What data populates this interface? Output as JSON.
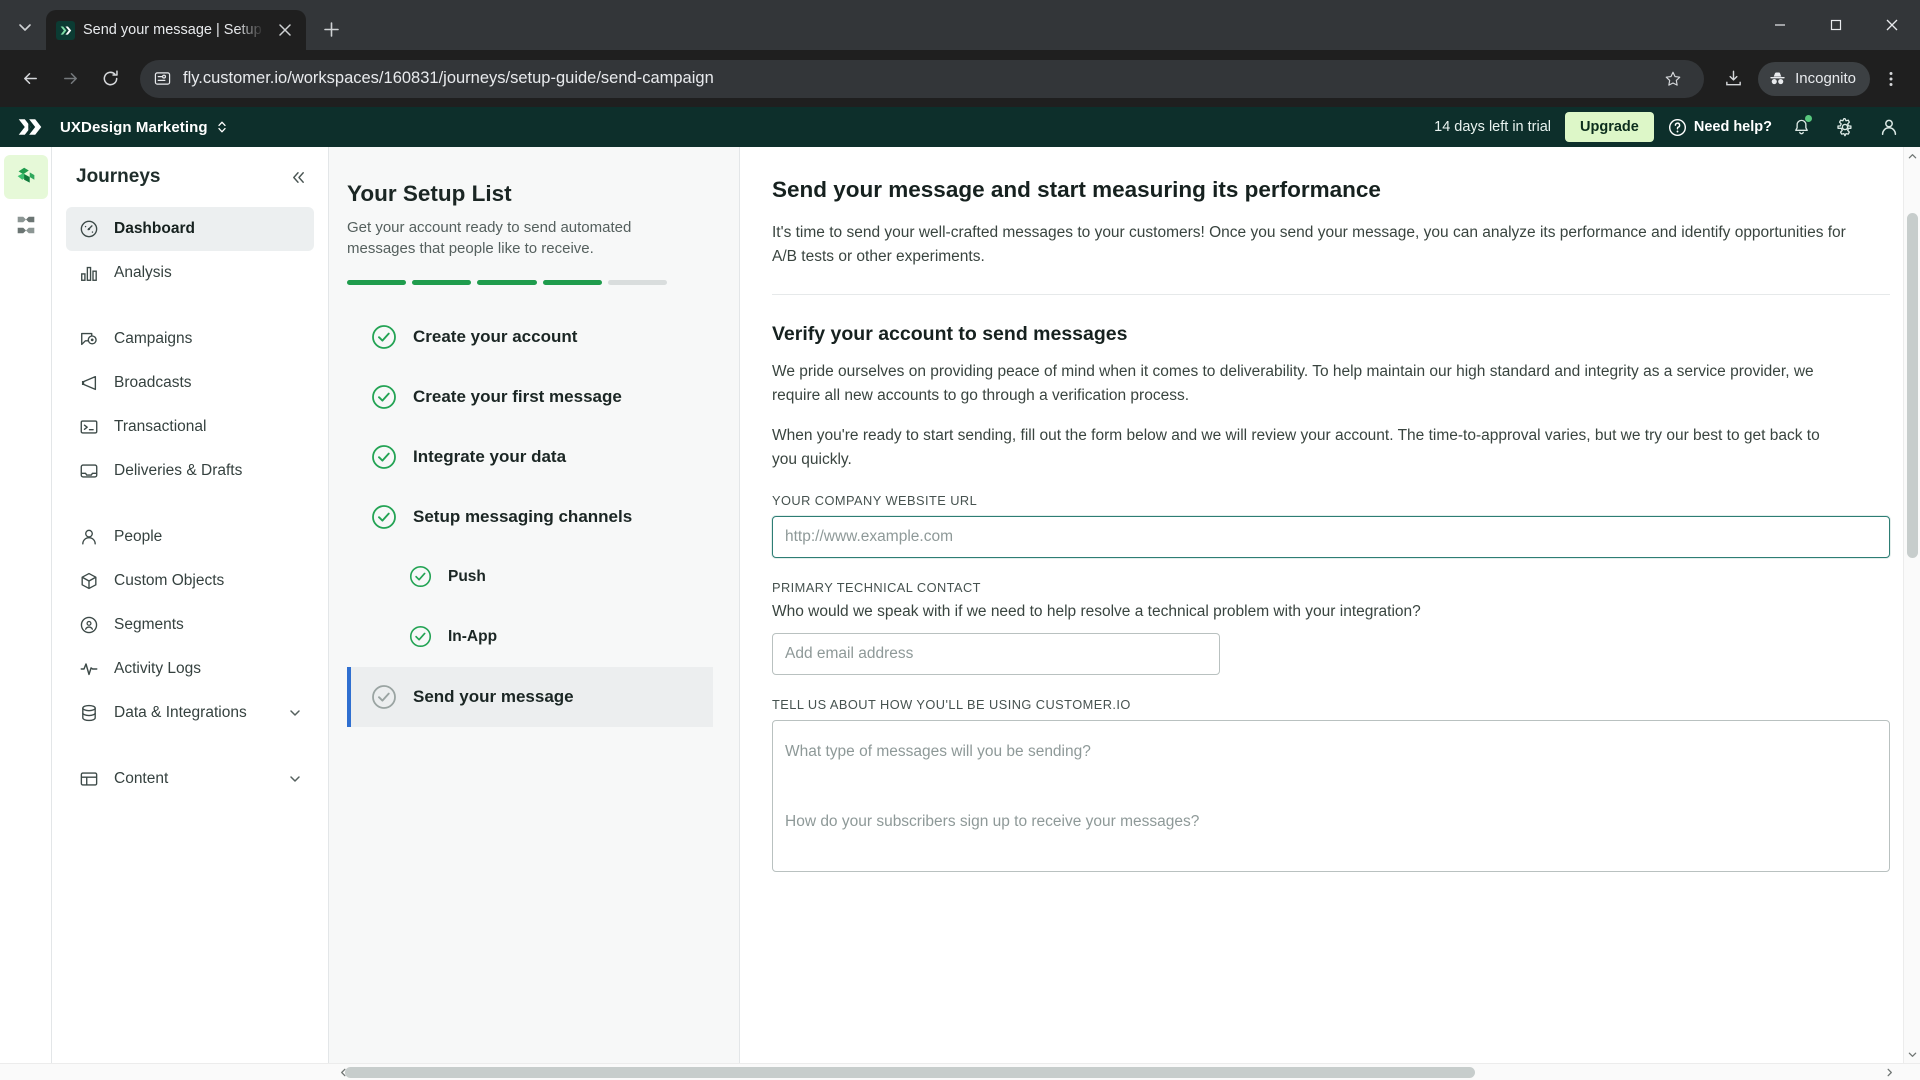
{
  "browser": {
    "tab": {
      "title": "Send your message | Setup Gui",
      "favicon_icon": "customerio-logo-icon",
      "close_icon": "close-icon"
    },
    "tab_list_icon": "chevron-down-icon",
    "new_tab_icon": "plus-icon",
    "window": {
      "minimize_icon": "minimize-icon",
      "maximize_icon": "maximize-icon",
      "close_icon": "close-icon"
    },
    "nav": {
      "back_icon": "arrow-back-icon",
      "forward_icon": "arrow-forward-icon",
      "reload_icon": "reload-icon"
    },
    "omnibox": {
      "site_info_icon": "site-settings-icon",
      "url": "fly.customer.io/workspaces/160831/journeys/setup-guide/send-campaign"
    },
    "toolbar": {
      "bookmark_icon": "star-icon",
      "download_icon": "download-icon",
      "menu_icon": "kebab-menu-icon"
    },
    "incognito": {
      "label": "Incognito",
      "icon": "incognito-icon"
    }
  },
  "app_header": {
    "logo_icon": "customerio-logo-icon",
    "workspace_name": "UXDesign Marketing",
    "workspace_switch_icon": "chevron-updown-icon",
    "trial_text": "14 days left in trial",
    "upgrade_label": "Upgrade",
    "need_help_label": "Need help?",
    "need_help_icon": "question-circle-icon",
    "notifications_icon": "bell-icon",
    "settings_icon": "gear-icon",
    "account_icon": "user-icon"
  },
  "rail": {
    "items": [
      {
        "name": "journeys",
        "icon": "journeys-logo-icon",
        "active": true
      },
      {
        "name": "data-pipelines",
        "icon": "pipelines-icon",
        "active": false
      }
    ]
  },
  "sidebar": {
    "title": "Journeys",
    "collapse_icon": "double-chevron-left-icon",
    "items": [
      {
        "label": "Dashboard",
        "icon": "gauge-icon",
        "active": true,
        "caret": false
      },
      {
        "label": "Analysis",
        "icon": "bar-chart-icon",
        "active": false,
        "caret": false
      },
      {
        "label": "Campaigns",
        "icon": "campaign-icon",
        "active": false,
        "caret": false
      },
      {
        "label": "Broadcasts",
        "icon": "megaphone-icon",
        "active": false,
        "caret": false
      },
      {
        "label": "Transactional",
        "icon": "terminal-icon",
        "active": false,
        "caret": false
      },
      {
        "label": "Deliveries & Drafts",
        "icon": "inbox-icon",
        "active": false,
        "caret": false
      },
      {
        "label": "People",
        "icon": "person-icon",
        "active": false,
        "caret": false
      },
      {
        "label": "Custom Objects",
        "icon": "cube-icon",
        "active": false,
        "caret": false
      },
      {
        "label": "Segments",
        "icon": "segment-icon",
        "active": false,
        "caret": false
      },
      {
        "label": "Activity Logs",
        "icon": "pulse-icon",
        "active": false,
        "caret": false
      },
      {
        "label": "Data & Integrations",
        "icon": "database-icon",
        "active": false,
        "caret": true
      },
      {
        "label": "Content",
        "icon": "table-icon",
        "active": false,
        "caret": true
      }
    ]
  },
  "setup_list": {
    "title": "Your Setup List",
    "subtitle": "Get your account ready to send automated messages that people like to receive.",
    "progress_segments": [
      true,
      true,
      true,
      true,
      false
    ],
    "items": [
      {
        "label": "Create your account",
        "state": "complete",
        "sub": false,
        "current": false
      },
      {
        "label": "Create your first message",
        "state": "complete",
        "sub": false,
        "current": false
      },
      {
        "label": "Integrate your data",
        "state": "complete",
        "sub": false,
        "current": false
      },
      {
        "label": "Setup messaging channels",
        "state": "complete",
        "sub": false,
        "current": false
      },
      {
        "label": "Push",
        "state": "complete",
        "sub": true,
        "current": false
      },
      {
        "label": "In-App",
        "state": "complete",
        "sub": true,
        "current": false
      },
      {
        "label": "Send your message",
        "state": "pending",
        "sub": false,
        "current": true
      }
    ]
  },
  "content": {
    "heading": "Send your message and start measuring its performance",
    "intro": "It's time to send your well-crafted messages to your customers! Once you send your message, you can analyze its performance and identify opportunities for A/B tests or other experiments.",
    "section_heading": "Verify your account to send messages",
    "section_p1": "We pride ourselves on providing peace of mind when it comes to deliverability. To help maintain our high standard and integrity as a service provider, we require all new accounts to go through a verification process.",
    "section_p2": "When you're ready to start sending, fill out the form below and we will review your account. The time-to-approval varies, but we try our best to get back to you quickly.",
    "fields": {
      "website": {
        "label": "YOUR COMPANY WEBSITE URL",
        "placeholder": "http://www.example.com",
        "value": ""
      },
      "contact": {
        "label": "PRIMARY TECHNICAL CONTACT",
        "help": "Who would we speak with if we need to help resolve a technical problem with your integration?",
        "placeholder": "Add email address",
        "value": ""
      },
      "usage": {
        "label": "TELL US ABOUT HOW YOU'LL BE USING CUSTOMER.IO",
        "placeholder": "What type of messages will you be sending?\n\nHow do your subscribers sign up to receive your messages?",
        "value": ""
      }
    }
  },
  "scrollbars": {
    "vertical_up_icon": "caret-up-icon",
    "vertical_down_icon": "caret-down-icon",
    "horizontal_left_icon": "caret-left-icon",
    "horizontal_right_icon": "caret-right-icon"
  },
  "colors": {
    "header_bg": "#0d2f2b",
    "upgrade_bg": "#ddf7c8",
    "progress_done": "#1f9c4d",
    "current_item_border": "#2f6fd0",
    "rail_active_bg": "#e6f9d8"
  }
}
